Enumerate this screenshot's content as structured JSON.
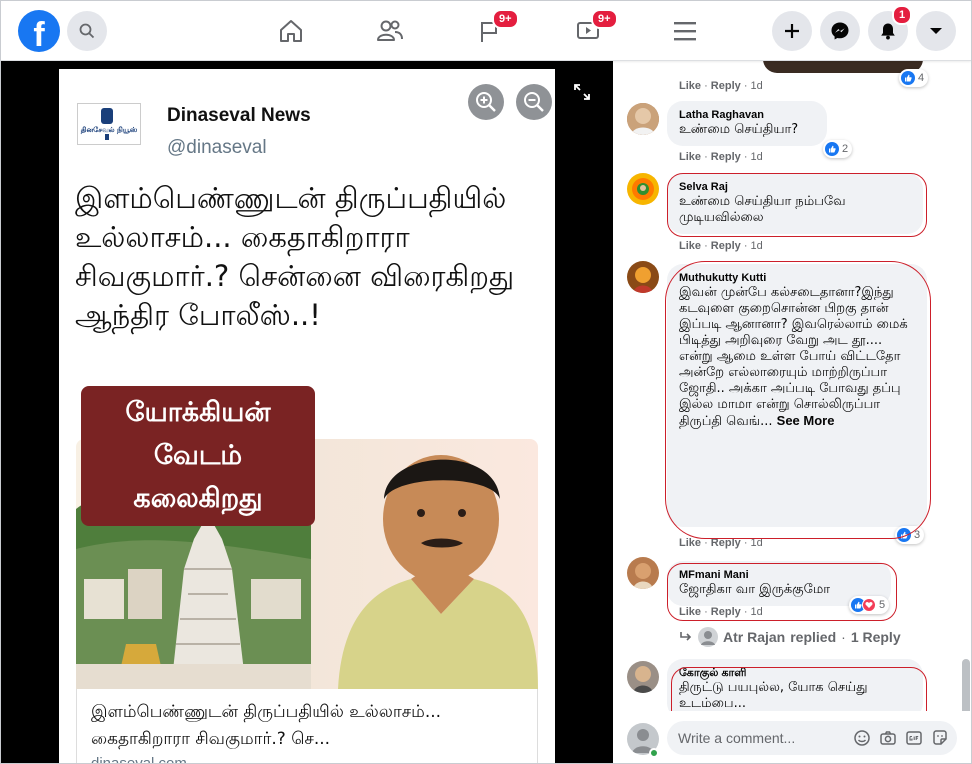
{
  "nav": {
    "logo_letter": "f",
    "badge_pages": "9+",
    "badge_watch": "9+",
    "badge_notifications": "1"
  },
  "viewer": {
    "source_name": "Dinaseval News",
    "source_handle": "@dinaseval",
    "source_logo_text": "தினசேவல் நியூஸ்",
    "headline": "இளம்பெண்ணுடன் திருப்பதியில் உல்லாசம்... கைதாகிறாரா சிவகுமார்.? சென்னை விரைகிறது ஆந்திர போலீஸ்..!",
    "caption_tag": [
      "யோக்கியன்",
      "வேடம்",
      "கலைகிறது"
    ],
    "link_title": "இளம்பெண்ணுடன் திருப்பதியில் உல்லாசம்... கைதாகிறாரா சிவகுமார்.? செ...",
    "link_domain": "dinaseval.com"
  },
  "comments": [
    {
      "id": "c0",
      "name": "",
      "text": "",
      "like": "Like",
      "reply": "Reply",
      "time": "1d",
      "reactions": "4"
    },
    {
      "id": "c1",
      "name": "Latha Raghavan",
      "text": "உண்மை செய்தியா?",
      "like": "Like",
      "reply": "Reply",
      "time": "1d",
      "reactions": "2"
    },
    {
      "id": "c2",
      "name": "Selva Raj",
      "text": "உண்மை செய்தியா நம்பவே முடியவில்லை",
      "like": "Like",
      "reply": "Reply",
      "time": "1d",
      "reactions": ""
    },
    {
      "id": "c3",
      "name": "Muthukutty Kutti",
      "text": "இவன் முன்பே கல்சடைதானா?இந்து கடவுளை குறைசொன்ன பிறகு தான் இப்படி ஆனானா? இவரெல்லாம் மைக் பிடித்து அறிவுரை வேறு அட தூ.... என்று ஆமை உள்ள போய் விட்டதோ அன்றே எல்லாரையும் மாற்றிருப்பா ஜோதி.. அக்கா அப்படி போவது தப்பு இல்ல மாமா என்று சொல்லிருப்பா திருப்தி வெங்...",
      "see_more": "See More",
      "like": "Like",
      "reply": "Reply",
      "time": "1d",
      "reactions": "3"
    },
    {
      "id": "c4",
      "name": "MFmani Mani",
      "text": "ஜோதிகா வா இருக்குமோ",
      "like": "Like",
      "reply": "Reply",
      "time": "1d",
      "reactions": "5"
    },
    {
      "id": "c5",
      "name": "கோகுல் காளி",
      "text": "திருட்டு பயபுல்ல, யோக செய்து உடம்பை...",
      "like": "",
      "reply": "",
      "time": "",
      "reactions": ""
    }
  ],
  "reply_thread": {
    "author": "Atr Rajan",
    "replied": "replied",
    "count": "1 Reply"
  },
  "composer": {
    "placeholder": "Write a comment..."
  }
}
